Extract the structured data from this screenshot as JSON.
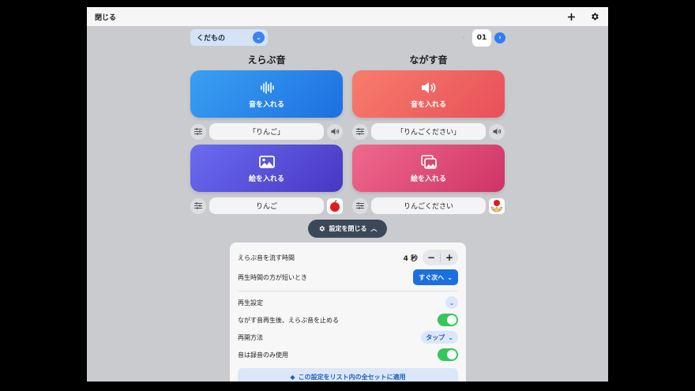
{
  "topbar": {
    "close_label": "閉じる",
    "add_icon": "plus-icon",
    "settings_icon": "gear-icon"
  },
  "category": {
    "label": "くだもの"
  },
  "pager": {
    "page": "01"
  },
  "columns": {
    "select": {
      "title": "えらぶ音",
      "sound_button": "音を入れる",
      "sound_text": "「りんご」",
      "image_button": "絵を入れる",
      "image_text": "りんご"
    },
    "play": {
      "title": "ながす音",
      "sound_button": "音を入れる",
      "sound_text": "「りんごください」",
      "image_button": "絵を入れる",
      "image_text": "りんごください"
    }
  },
  "settings_toggle": {
    "label": "設定を閉じる"
  },
  "settings": {
    "select_sound_duration": {
      "label": "えらぶ音を流す時間",
      "value": "4 秒"
    },
    "short_playback": {
      "label": "再生時間の方が短いとき",
      "value": "すぐ次へ"
    },
    "playback_settings": {
      "label": "再生設定"
    },
    "stop_after_play": {
      "label": "ながす音再生後、えらぶ音を止める",
      "on": true
    },
    "resume_method": {
      "label": "再開方法",
      "value": "タップ"
    },
    "recording_only": {
      "label": "音は録音のみ使用",
      "on": true
    },
    "apply_all": {
      "label": "この設定をリスト内の全セットに適用"
    }
  },
  "colors": {
    "accent": "#1c6fe0",
    "toggle_on": "#34c759",
    "panel_bg": "#f7f7f8",
    "app_bg": "#c9cbcf"
  }
}
